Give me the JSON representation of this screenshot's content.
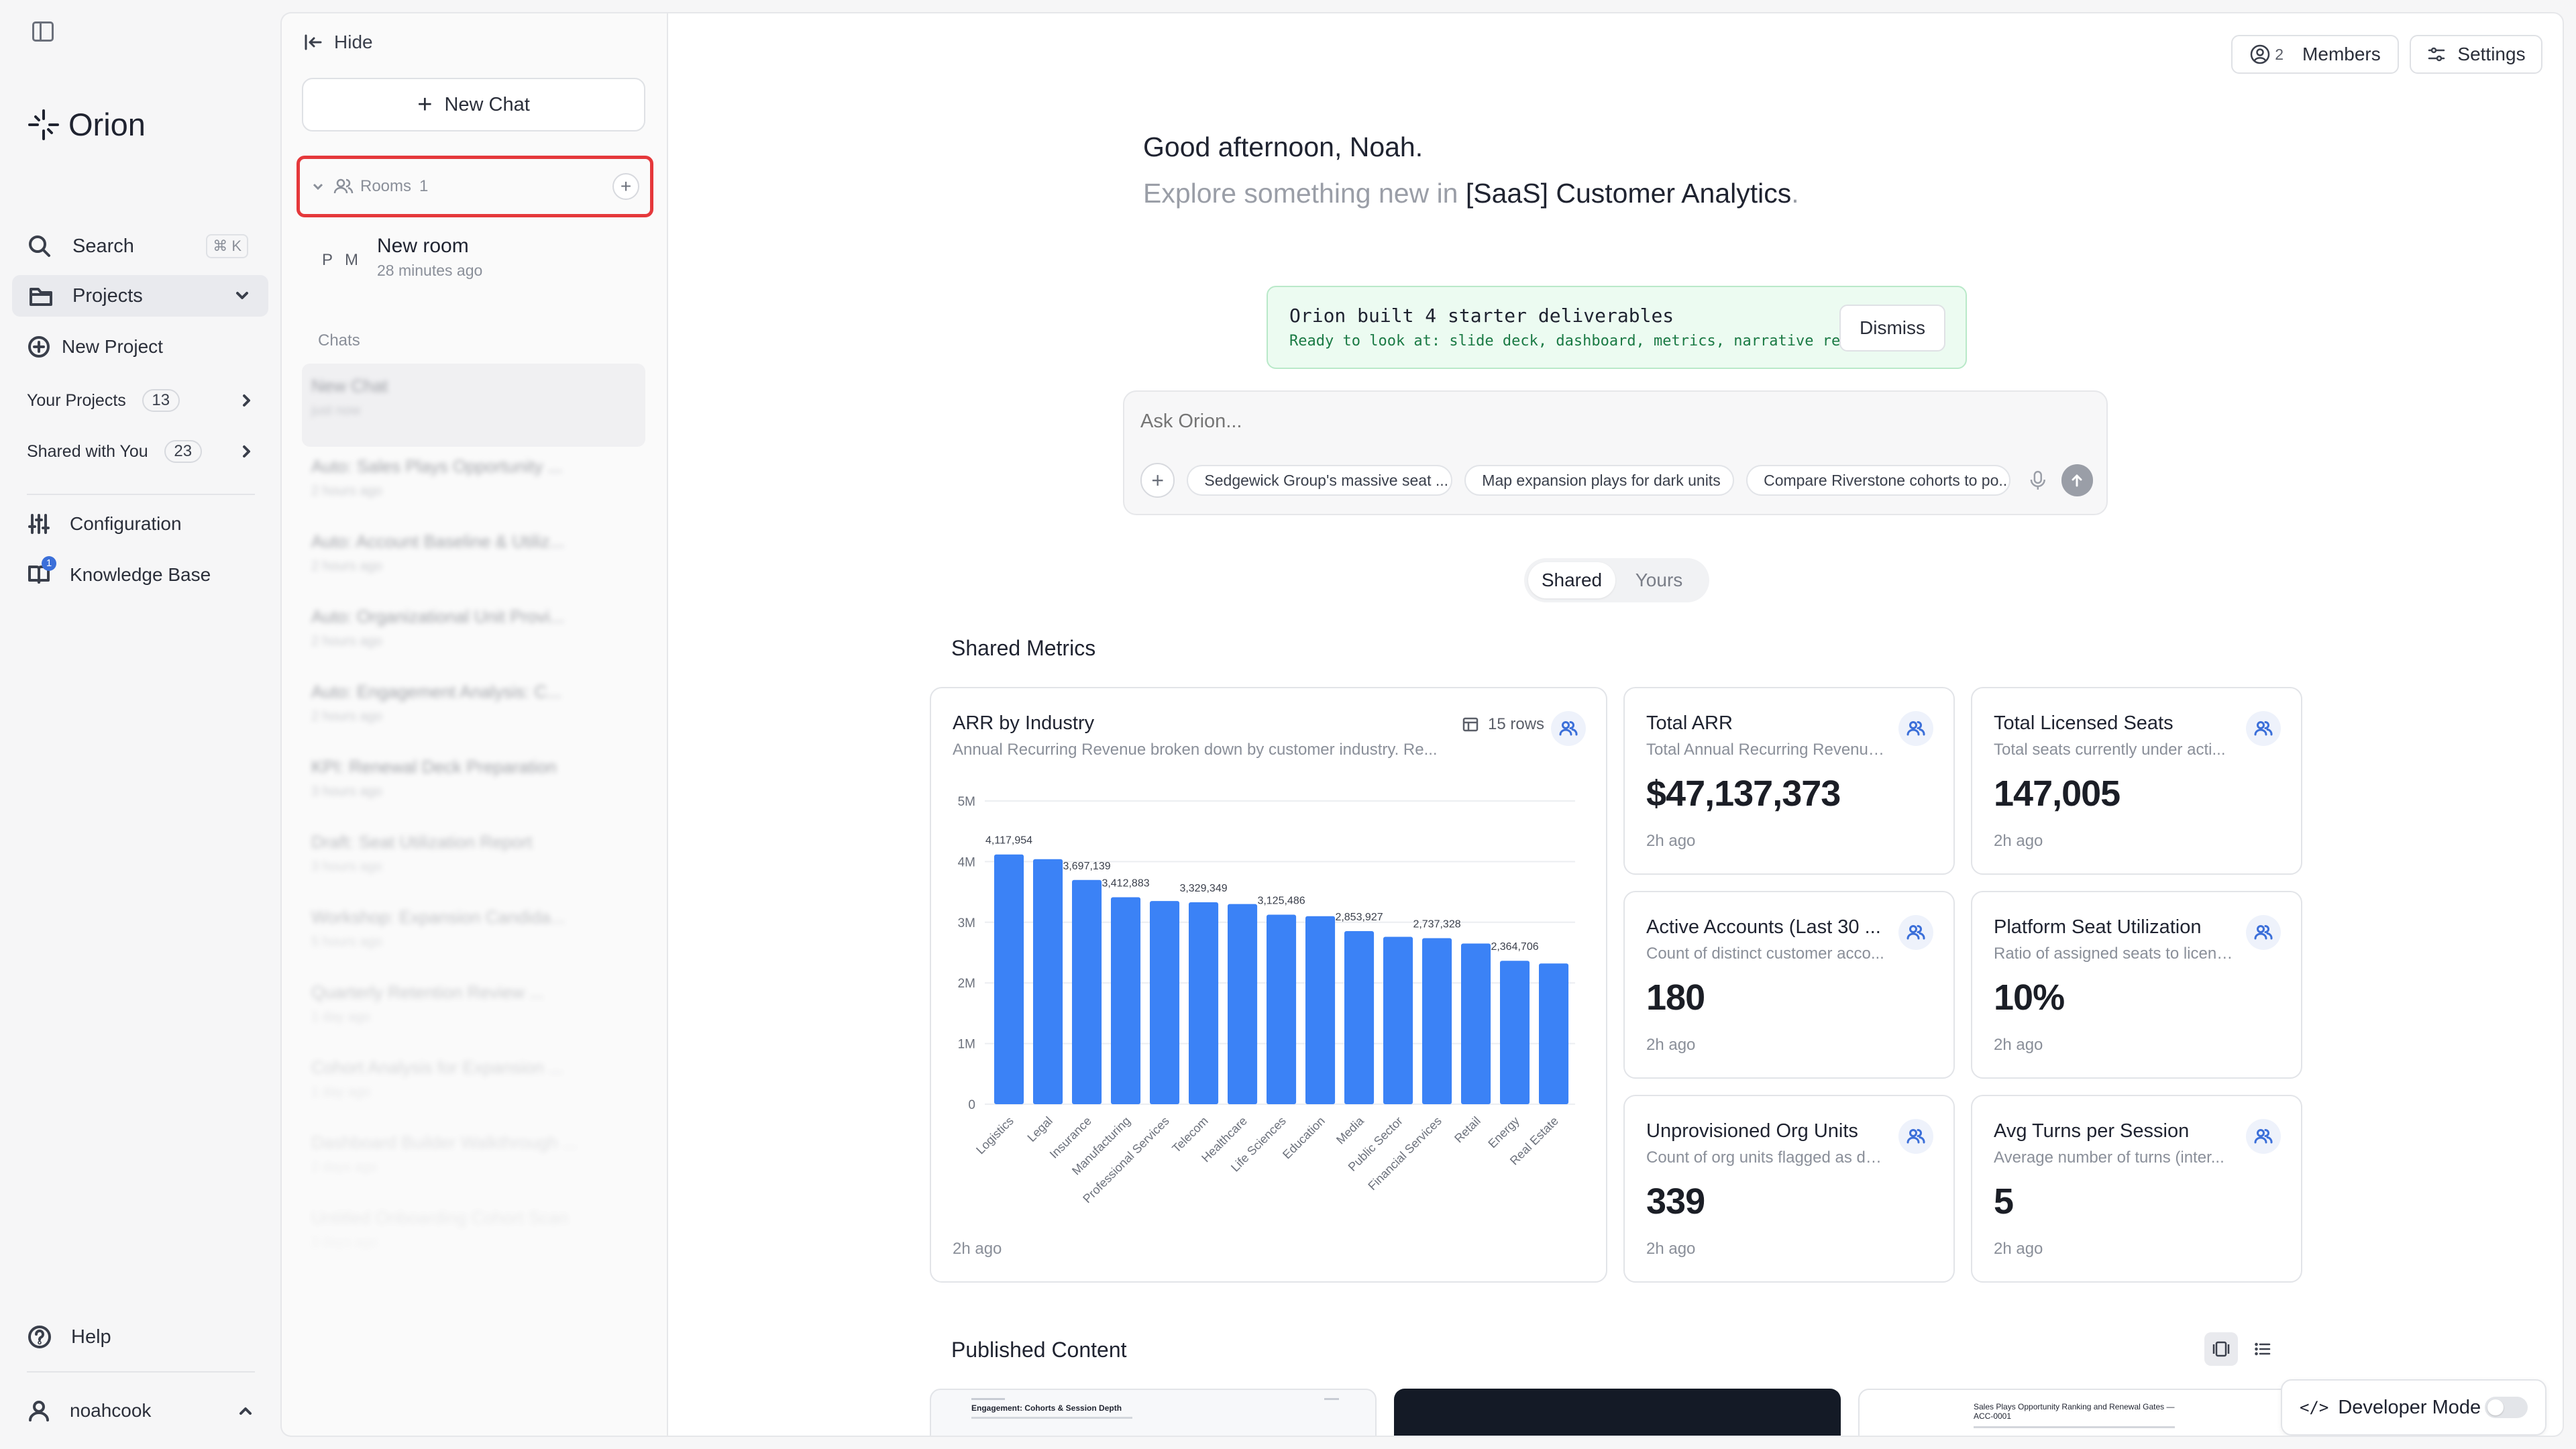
{
  "app": {
    "name": "Orion"
  },
  "sidebar": {
    "search": {
      "label": "Search",
      "shortcut": "⌘ K"
    },
    "projects_label": "Projects",
    "new_project_label": "New Project",
    "your_projects": {
      "label": "Your Projects",
      "count": "13"
    },
    "shared_with_you": {
      "label": "Shared with You",
      "count": "23"
    },
    "configuration_label": "Configuration",
    "knowledge_base": {
      "label": "Knowledge Base",
      "badge": "1"
    },
    "help_label": "Help",
    "user": {
      "name": "noahcook"
    }
  },
  "panel": {
    "hide_label": "Hide",
    "new_chat_label": "New Chat",
    "rooms": {
      "label": "Rooms",
      "count": "1"
    },
    "room": {
      "initials": [
        "P",
        "M"
      ],
      "name": "New room",
      "time": "28 minutes ago"
    },
    "chats_label": "Chats",
    "chats": [
      {
        "title": "New Chat",
        "time": "just now"
      },
      {
        "title": "Auto: Sales Plays Opportunity ...",
        "time": "2 hours ago"
      },
      {
        "title": "Auto: Account Baseline & Utiliz...",
        "time": "2 hours ago"
      },
      {
        "title": "Auto: Organizational Unit Provi...",
        "time": "2 hours ago"
      },
      {
        "title": "Auto: Engagement Analysis: C...",
        "time": "2 hours ago"
      },
      {
        "title": "KPI: Renewal Deck Preparation",
        "time": "3 hours ago"
      },
      {
        "title": "Draft: Seat Utilization Report",
        "time": "3 hours ago"
      },
      {
        "title": "Workshop: Expansion Candida...",
        "time": "5 hours ago"
      },
      {
        "title": "Quarterly Retention Review ...",
        "time": "1 day ago"
      },
      {
        "title": "Cohort Analysis for Expansion ...",
        "time": "1 day ago"
      },
      {
        "title": "Dashboard Builder Walkthrough ...",
        "time": "2 days ago"
      },
      {
        "title": "Untitled Onboarding Cohort Scan",
        "time": "3 days ago"
      }
    ]
  },
  "header": {
    "members_count": "2",
    "members_label": "Members",
    "settings_label": "Settings"
  },
  "greeting": {
    "line1": "Good afternoon, Noah.",
    "line2_prefix": "Explore something new in ",
    "project": "[SaaS] Customer Analytics",
    "line2_suffix": "."
  },
  "banner": {
    "title": "Orion built 4 starter deliverables",
    "subtitle": "Ready to look at: slide deck, dashboard, metrics, narrative report.",
    "dismiss_label": "Dismiss"
  },
  "composer": {
    "placeholder": "Ask Orion...",
    "suggestions": [
      "Sedgewick Group's massive seat ...",
      "Map expansion plays for dark units",
      "Compare Riverstone cohorts to po..."
    ]
  },
  "toggle": {
    "shared": "Shared",
    "yours": "Yours",
    "active": "shared"
  },
  "shared_metrics_title": "Shared Metrics",
  "chart_card": {
    "title": "ARR by Industry",
    "subtitle": "Annual Recurring Revenue broken down by customer industry. Re...",
    "rows_label": "15 rows",
    "time": "2h ago"
  },
  "chart_data": {
    "type": "bar",
    "title": "ARR by Industry",
    "categories": [
      "Logistics",
      "Legal",
      "Insurance",
      "Manufacturing",
      "Professional Services",
      "Telecom",
      "Healthcare",
      "Life Sciences",
      "Education",
      "Media",
      "Public Sector",
      "Financial Services",
      "Retail",
      "Energy",
      "Real Estate"
    ],
    "values": [
      4117954,
      4040000,
      3697139,
      3412883,
      3350000,
      3329349,
      3300000,
      3125486,
      3100000,
      2853927,
      2760000,
      2737328,
      2650000,
      2364706,
      2320000
    ],
    "data_labels": {
      "0": "4,117,954",
      "2": "3,697,139",
      "3": "3,412,883",
      "5": "3,329,349",
      "7": "3,125,486",
      "9": "2,853,927",
      "11": "2,737,328",
      "13": "2,364,706"
    },
    "yticks": [
      "0",
      "1M",
      "2M",
      "3M",
      "4M",
      "5M"
    ],
    "ylim": [
      0,
      5000000
    ],
    "color": "#3b82f6",
    "grid": true
  },
  "metrics": [
    {
      "title": "Total ARR",
      "subtitle": "Total Annual Recurring Revenue ...",
      "value": "$47,137,373",
      "time": "2h ago"
    },
    {
      "title": "Total Licensed Seats",
      "subtitle": "Total seats currently under acti...",
      "value": "147,005",
      "time": "2h ago"
    },
    {
      "title": "Active Accounts (Last 30 ...",
      "subtitle": "Count of distinct customer acco...",
      "value": "180",
      "time": "2h ago"
    },
    {
      "title": "Platform Seat Utilization",
      "subtitle": "Ratio of assigned seats to licens...",
      "value": "10%",
      "time": "2h ago"
    },
    {
      "title": "Unprovisioned Org Units",
      "subtitle": "Count of org units flagged as da...",
      "value": "339",
      "time": "2h ago"
    },
    {
      "title": "Avg Turns per Session",
      "subtitle": "Average number of turns (inter...",
      "value": "5",
      "time": "2h ago"
    }
  ],
  "published_title": "Published Content",
  "published": [
    {
      "title": "Engagement: Cohorts & Session Depth"
    },
    {
      "title": ""
    },
    {
      "title": "Sales Plays Opportunity Ranking and Renewal Gates — ACC-0001"
    }
  ],
  "developer_mode": {
    "label": "Developer Mode",
    "enabled": false
  },
  "colors": {
    "accent": "#3b82f6",
    "highlight": "#e5383b",
    "banner_bg": "#ecfbf1",
    "banner_border": "#b9e9c9"
  }
}
